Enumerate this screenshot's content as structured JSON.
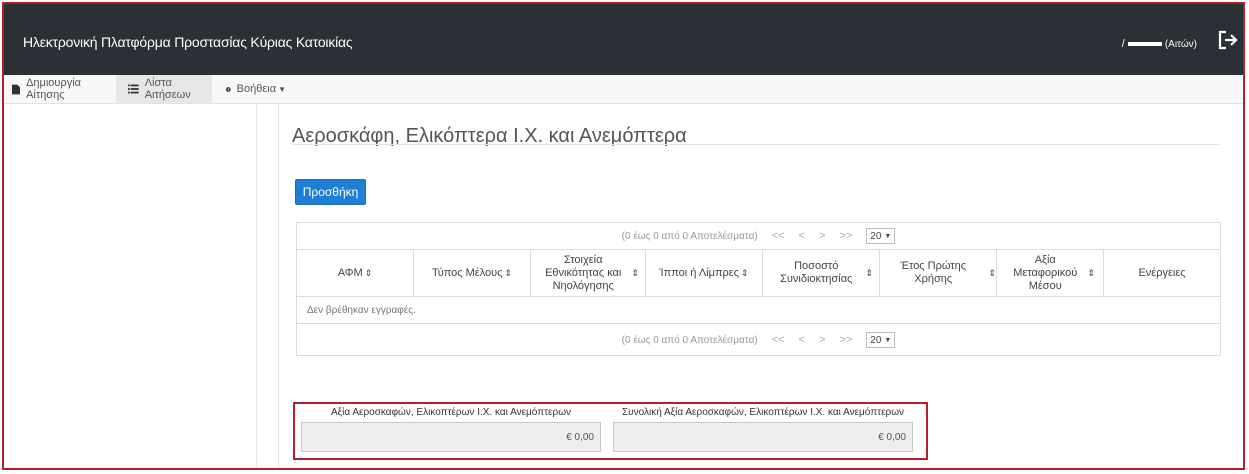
{
  "header": {
    "app_title": "Ηλεκτρονική Πλατφόρμα Προστασίας Κύριας Κατοικίας",
    "user_slash": "/",
    "user_suffix": "(Αιτών)"
  },
  "nav": {
    "items": [
      {
        "label": "Δημιουργία Αίτησης",
        "icon": "file-icon"
      },
      {
        "label": "Λίστα Αιτήσεων",
        "icon": "list-icon"
      },
      {
        "label": "Βοήθεια",
        "icon": "question-circle-icon"
      }
    ]
  },
  "section": {
    "title": "Αεροσκάφη, Ελικόπτερα Ι.Χ. και Ανεμόπτερα",
    "add_button": "Προσθήκη"
  },
  "table": {
    "paginator": {
      "summary": "(0 έως 0 από 0 Αποτελέσματα)",
      "first": "<<",
      "prev": "<",
      "next": ">",
      "last": ">>",
      "page_size": "20"
    },
    "columns": [
      {
        "label": "ΑΦΜ",
        "sortable": true
      },
      {
        "label": "Τύπος Μέλους",
        "sortable": true
      },
      {
        "label": "Στοιχεία Εθνικότητας και Νηολόγησης",
        "sortable": true
      },
      {
        "label": "Ίπποι ή Λίμπρες",
        "sortable": true
      },
      {
        "label": "Ποσοστό Συνιδιοκτησίας",
        "sortable": true
      },
      {
        "label": "Έτος Πρώτης Χρήσης",
        "sortable": true
      },
      {
        "label": "Αξία Μεταφορικού Μέσου",
        "sortable": true
      },
      {
        "label": "Ενέργειες",
        "sortable": false
      }
    ],
    "empty_message": "Δεν βρέθηκαν εγγραφές."
  },
  "totals": {
    "value_label": "Αξία Αεροσκαφών, Ελικοπτέρων Ι.Χ. και Ανεμόπτερων",
    "value": "€ 0,00",
    "total_label": "Συνολική Αξία Αεροσκαφών, Ελικοπτέρων Ι.Χ. και Ανεμόπτερων",
    "total_value": "€ 0,00"
  },
  "colors": {
    "header_bg": "#2a3035",
    "accent_blue": "#1f7fd6",
    "highlight_red": "#b0212b"
  }
}
